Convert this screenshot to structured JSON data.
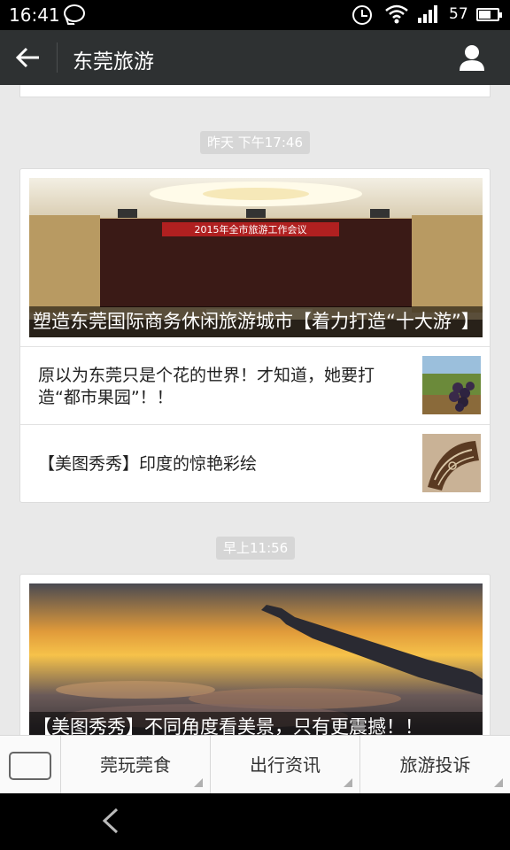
{
  "status_bar": {
    "time": "16:41",
    "battery": "57",
    "icons": [
      "chat-bubble-icon",
      "alarm-icon",
      "wifi-icon",
      "signal-3g-icon",
      "battery-icon"
    ]
  },
  "header": {
    "title": "东莞旅游",
    "back_icon": "arrow-left-icon",
    "profile_icon": "person-icon"
  },
  "feed": {
    "groups": [
      {
        "timestamp": "昨天 下午17:46",
        "main_article": {
          "title": "塑造东莞国际商务休闲旅游城市【着力打造“十大游”】",
          "image_banner_text": "2015年全市旅游工作会议"
        },
        "sub_articles": [
          {
            "title": "原以为东莞只是个花的世界！才知道，她要打造“都市果园”！！"
          },
          {
            "title": "【美图秀秀】印度的惊艳彩绘"
          }
        ]
      },
      {
        "timestamp": "早上11:56",
        "main_article": {
          "title": "【美图秀秀】不同角度看美景，只有更震撼！！"
        }
      }
    ]
  },
  "menu": {
    "keyboard_icon": "keyboard-icon",
    "items": [
      {
        "label": "莞玩莞食"
      },
      {
        "label": "出行资讯"
      },
      {
        "label": "旅游投诉"
      }
    ]
  },
  "navbar": {
    "back_icon": "nav-back-icon"
  },
  "colors": {
    "header_bg": "#2e3132",
    "feed_bg": "#e9e9e9",
    "banner_red": "#b02020"
  }
}
